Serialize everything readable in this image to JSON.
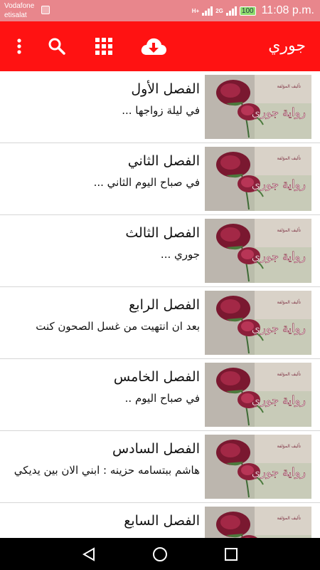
{
  "status_bar": {
    "carrier_line1": "Vodafone",
    "carrier_line2": "etisalat",
    "network1": "H+",
    "network2": "2G",
    "battery": "100",
    "time": "11:08 p.m.",
    "bg_color": "#e8868c"
  },
  "app_bar": {
    "title": "جوري",
    "bg_color": "#ff1212",
    "icons": [
      "more-vert-icon",
      "search-icon",
      "apps-grid-icon",
      "cloud-download-icon"
    ]
  },
  "chapters": [
    {
      "title": "الفصل الأول",
      "subtitle": "في ليلة زواجها ..."
    },
    {
      "title": "الفصل الثاني",
      "subtitle": "في صباح اليوم الثاني ..."
    },
    {
      "title": "الفصل الثالث",
      "subtitle": "جوري ..."
    },
    {
      "title": "الفصل الرابع",
      "subtitle": "بعد ان انتهيت من غسل الصحون كنت"
    },
    {
      "title": "الفصل الخامس",
      "subtitle": "في صباح اليوم .."
    },
    {
      "title": "الفصل السادس",
      "subtitle": "هاشم ببتسامه حزينه : ابني الان بين يديكي"
    },
    {
      "title": "الفصل السابع",
      "subtitle": ""
    }
  ],
  "thumbnail": {
    "caption": "رواية جوري",
    "small_text": "تأليف المؤلفة"
  },
  "nav_bar": {
    "icons": [
      "back-icon",
      "home-icon",
      "recents-icon"
    ]
  }
}
